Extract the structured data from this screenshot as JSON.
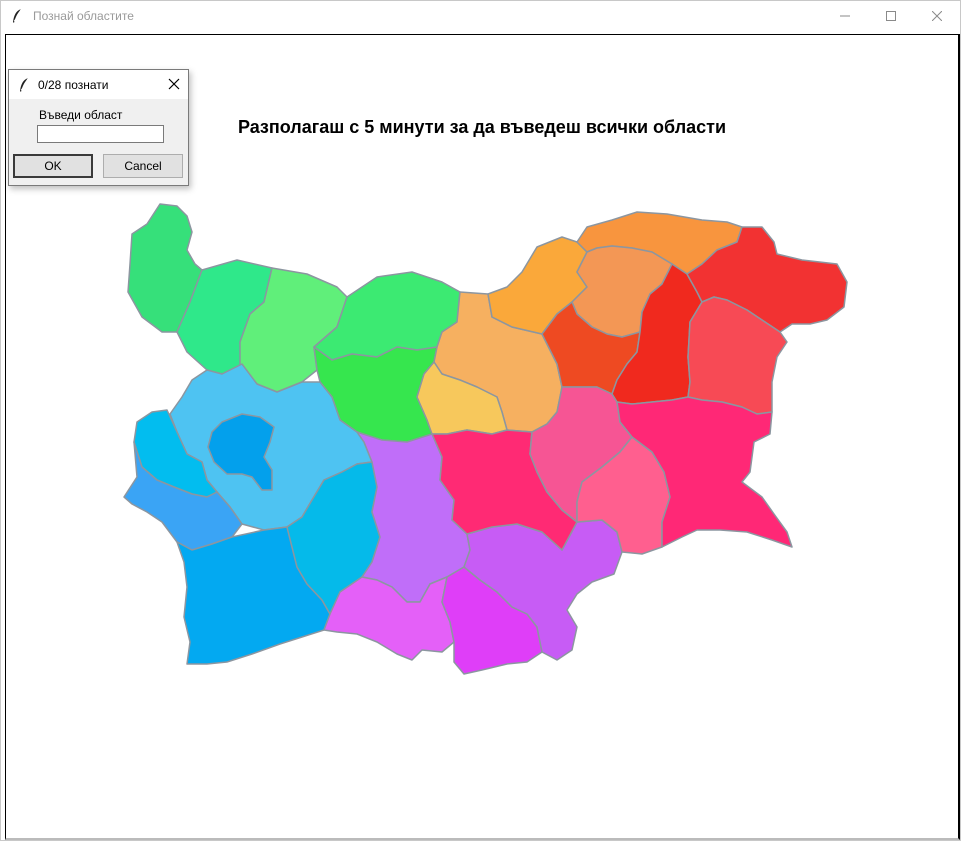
{
  "window": {
    "title": "Познай областите",
    "icon": "feather-icon"
  },
  "instruction": "Разполагаш с 5 минути за да въведеш всички области",
  "dialog": {
    "title": "0/28 познати",
    "prompt": "Въведи област",
    "input_value": "",
    "ok_label": "OK",
    "cancel_label": "Cancel"
  },
  "map": {
    "region_count": 28,
    "border_color": "#8c96a0",
    "palette": {
      "green": "#36e07a",
      "teal": "#2fe88a",
      "cyan": "#4ec3f2",
      "blue": "#03a9f4",
      "purple": "#c26cf7",
      "magenta": "#e040fb",
      "orange": "#f8953e",
      "red": "#f03030",
      "pink": "#ff2d72"
    }
  }
}
